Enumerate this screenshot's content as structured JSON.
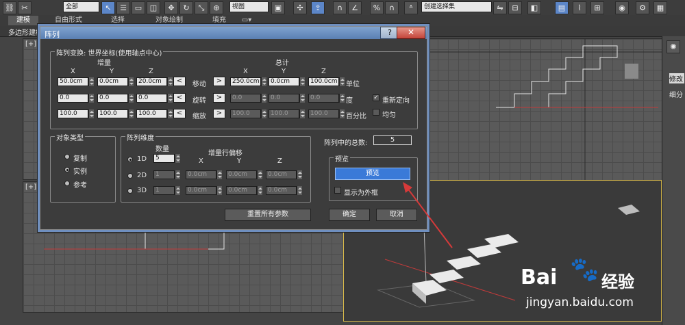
{
  "toolbar": {
    "selection_filter": "全部",
    "viewport_dropdown": "视图",
    "named_selection": "创建选择集"
  },
  "ribbon": {
    "tabs": [
      "建模",
      "自由形式",
      "选择",
      "对象绘制",
      "填充"
    ],
    "sub_label": "多边形建模"
  },
  "viewports": {
    "top_left_label": "[+][",
    "mid_left_label": "[+][",
    "axis_label": "x"
  },
  "command_panel": {
    "modify_label": "修改",
    "subdivide_label": "细分"
  },
  "dialog": {
    "title": "阵列",
    "help_button": "?",
    "close_button": "✕",
    "transform_group": "阵列变换: 世界坐标(使用轴点中心)",
    "increment_label": "增量",
    "totals_label": "总计",
    "axis_headers": [
      "X",
      "Y",
      "Z"
    ],
    "rows": [
      {
        "label": "移动",
        "inc": [
          "50.0cm",
          "0.0cm",
          "20.0cm"
        ],
        "total": [
          "250.0cm",
          "0.0cm",
          "100.0cm"
        ],
        "unit": "单位"
      },
      {
        "label": "旋转",
        "inc": [
          "0.0",
          "0.0",
          "0.0"
        ],
        "total": [
          "0.0",
          "0.0",
          "0.0"
        ],
        "unit": "度"
      },
      {
        "label": "缩放",
        "inc": [
          "100.0",
          "100.0",
          "100.0"
        ],
        "total": [
          "100.0",
          "100.0",
          "100.0"
        ],
        "unit": "百分比"
      }
    ],
    "arrow_left": "<",
    "arrow_right": ">",
    "reorient_label": "重新定向",
    "reorient_checked": true,
    "uniform_label": "均匀",
    "uniform_checked": false,
    "object_type": {
      "title": "对象类型",
      "options": [
        "复制",
        "实例",
        "参考"
      ],
      "selected": "实例"
    },
    "array_dimensions": {
      "title": "阵列维度",
      "count_label": "数量",
      "offset_label": "增量行偏移",
      "axis_headers": [
        "X",
        "Y",
        "Z"
      ],
      "dims": [
        {
          "label": "1D",
          "count": "5",
          "offsets": []
        },
        {
          "label": "2D",
          "count": "1",
          "offsets": [
            "0.0cm",
            "0.0cm",
            "0.0cm"
          ]
        },
        {
          "label": "3D",
          "count": "1",
          "offsets": [
            "0.0cm",
            "0.0cm",
            "0.0cm"
          ]
        }
      ],
      "selected": "1D"
    },
    "total_in_array_label": "阵列中的总数:",
    "total_in_array_value": "5",
    "preview": {
      "title": "预览",
      "button": "预览",
      "show_box_label": "显示为外框",
      "show_box_checked": false
    },
    "reset_button": "重置所有参数",
    "ok_button": "确定",
    "cancel_button": "取消"
  },
  "watermark": {
    "brand": "Bai",
    "brand2": "经验",
    "url": "jingyan.baidu.com"
  },
  "colors": {
    "accent_blue": "#3a7ad8",
    "annotation_red": "#d63a3a",
    "viewport_active_border": "#d6b84a"
  }
}
